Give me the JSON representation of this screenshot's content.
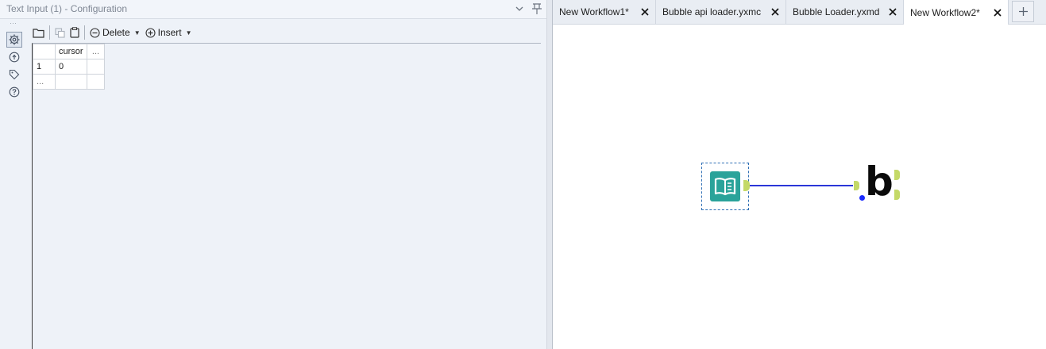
{
  "config_panel": {
    "title": "Text Input (1) - Configuration",
    "header_icons": [
      "chevron-down-icon",
      "pin-icon"
    ],
    "rail_icons": [
      "settings-gear-icon",
      "navigate-icon",
      "tag-icon",
      "help-icon"
    ],
    "toolbar": {
      "open_icon": "folder-icon",
      "copy_icon": "copy-icon",
      "paste_icon": "clipboard-icon",
      "delete_label": "Delete",
      "insert_label": "Insert"
    },
    "grid": {
      "column_headers": [
        "cursor",
        "..."
      ],
      "rows": [
        {
          "row_number": "1",
          "cells": [
            "0",
            ""
          ]
        }
      ],
      "add_row_placeholder": "..."
    }
  },
  "tabs": [
    {
      "label": "New Workflow1*",
      "active": false
    },
    {
      "label": "Bubble api loader.yxmc",
      "active": false
    },
    {
      "label": "Bubble Loader.yxmd",
      "active": false
    },
    {
      "label": "New Workflow2*",
      "active": true
    }
  ],
  "canvas": {
    "tools": [
      {
        "name": "Text Input",
        "icon": "book-icon",
        "selected": true
      },
      {
        "name": "Bubble",
        "icon": "bubble-logo",
        "logo_text": "b"
      }
    ],
    "connector_color": "#2b36d8"
  },
  "colors": {
    "text_input_tool": "#2aa39a",
    "anchor": "#c4d967",
    "selection": "#2f6fb5"
  }
}
